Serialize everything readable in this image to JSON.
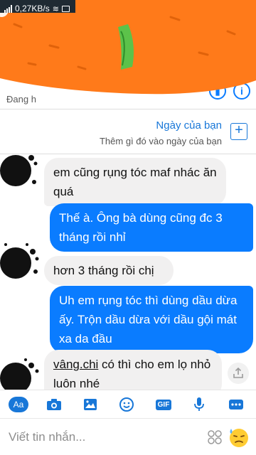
{
  "status_bar": {
    "network_speed": "0,27KB/s"
  },
  "header": {
    "status_text": "Đang h"
  },
  "day_card": {
    "title": "Ngày của bạn",
    "subtitle": "Thêm gì đó vào ngày của bạn",
    "add_label": "+"
  },
  "messages": [
    {
      "side": "received",
      "text": "em cũng rụng tóc maf nhác ăn quá"
    },
    {
      "side": "sent",
      "text": "Thế à. Ông bà dùng cũng đc 3 tháng rồi nhỉ"
    },
    {
      "side": "received",
      "text": "hơn 3 tháng rồi chị"
    },
    {
      "side": "sent",
      "text": "Uh em rụng tóc thì dùng dầu dừa ấy. Trộn dầu dừa với dầu gội mát xa da đầu"
    },
    {
      "side": "received",
      "link": "vâng.chi",
      "text": " có thì cho em lọ nhỏ luôn nhé"
    }
  ],
  "toolbar": {
    "aa_label": "Aa",
    "gif_label": "GIF",
    "icons": [
      "text-style-icon",
      "camera-icon",
      "image-icon",
      "sticker-icon",
      "gif-icon",
      "microphone-icon",
      "more-icon"
    ]
  },
  "composer": {
    "placeholder": "Viết tin nhắn..."
  },
  "colors": {
    "sent_bubble": "#0a7cff",
    "received_bubble": "#f1f0f0",
    "accent": "#1877d8",
    "carrot": "#ff7a1a"
  }
}
